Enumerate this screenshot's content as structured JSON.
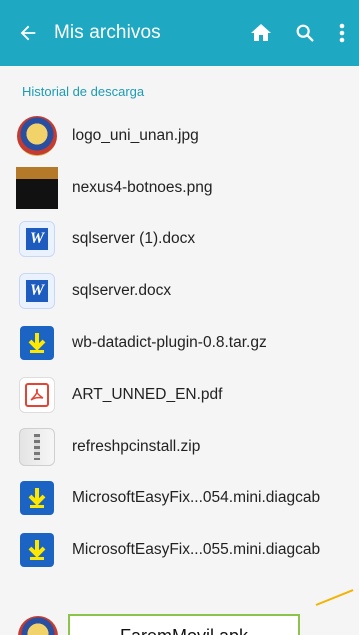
{
  "app": {
    "title": "Mis archivos"
  },
  "header": {
    "back_icon": "arrow-left-icon",
    "home_icon": "home-icon",
    "search_icon": "search-icon",
    "more_icon": "more-vertical-icon"
  },
  "section": {
    "title": "Historial de descarga"
  },
  "files": [
    {
      "name": "logo_uni_unan.jpg",
      "icon": "university-seal-icon"
    },
    {
      "name": "nexus4-botnoes.png",
      "icon": "image-thumbnail-icon"
    },
    {
      "name": "sqlserver (1).docx",
      "icon": "word-doc-icon"
    },
    {
      "name": "sqlserver.docx",
      "icon": "word-doc-icon"
    },
    {
      "name": "wb-datadict-plugin-0.8.tar.gz",
      "icon": "download-icon"
    },
    {
      "name": "ART_UNNED_EN.pdf",
      "icon": "pdf-icon"
    },
    {
      "name": "refreshpcinstall.zip",
      "icon": "zip-icon"
    },
    {
      "name": "MicrosoftEasyFix...054.mini.diagcab",
      "icon": "download-icon"
    },
    {
      "name": "MicrosoftEasyFix...055.mini.diagcab",
      "icon": "download-icon"
    }
  ],
  "highlight": {
    "label": "FaremMovil.apk"
  },
  "colors": {
    "topbar": "#1fa8c1",
    "section": "#1e9bb5",
    "highlight_border": "#8cc34a",
    "arrow": "#f2b400"
  }
}
